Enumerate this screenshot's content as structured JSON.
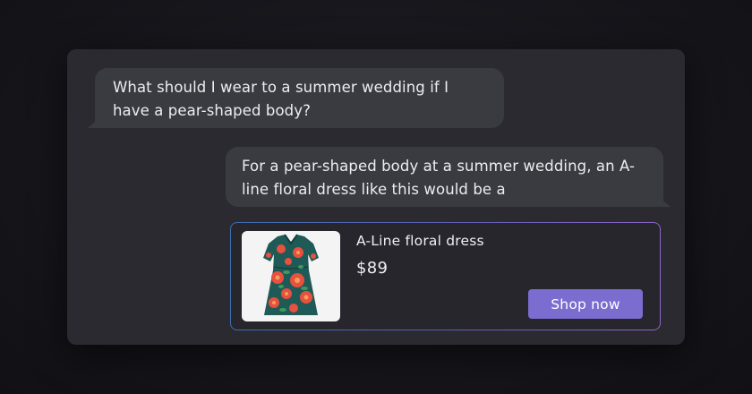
{
  "conversation": {
    "user_message": "What should I wear to a summer wedding if I have a pear-shaped body?",
    "assistant_message": "For a pear-shaped body at a summer wedding, an A-line floral dress like this would be a"
  },
  "product": {
    "name": "A-Line floral dress",
    "price": "$89",
    "cta_label": "Shop now",
    "image_icon": "floral-dress-image"
  },
  "colors": {
    "background": "#141419",
    "panel": "#2a2a30",
    "bubble": "#3a3a41",
    "button": "#7b6cd0",
    "card_border_start": "#3f6fb0",
    "card_border_end": "#8d66c6"
  }
}
